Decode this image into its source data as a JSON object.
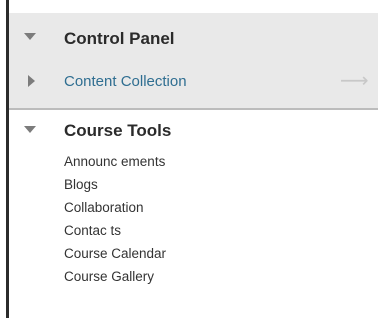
{
  "control_panel": {
    "title": "Control Panel",
    "expanded": true,
    "items": [
      {
        "label": "Content Collection",
        "collapsed": true,
        "link_color": "#2f6e91",
        "trailing_icon": "arrow-right-icon"
      }
    ]
  },
  "course_tools": {
    "title": "Course Tools",
    "expanded": true,
    "items": [
      {
        "label": "Announc ements"
      },
      {
        "label": "Blogs"
      },
      {
        "label": "Collaboration"
      },
      {
        "label": "Contac ts"
      },
      {
        "label": "Course Calendar"
      },
      {
        "label": "Course Gallery"
      }
    ]
  },
  "colors": {
    "section_background": "#e9e9e9",
    "heading_text": "#2b2b2b",
    "link_text": "#2f6e91",
    "triangle": "#7c7c7c",
    "left_border": "#2b2b2b"
  }
}
